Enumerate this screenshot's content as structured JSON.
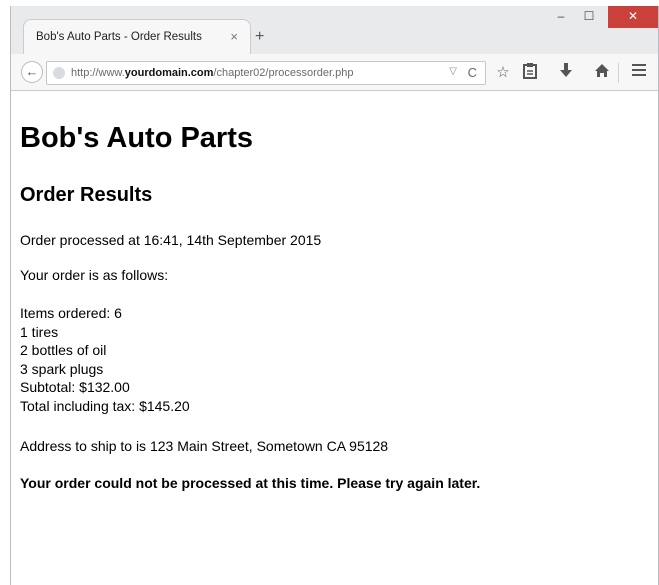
{
  "browser": {
    "tab_title": "Bob's Auto Parts - Order Results",
    "tab_close": "×",
    "new_tab": "+",
    "controls": {
      "minimize": "–",
      "maximize": "☐",
      "close": "✕"
    },
    "back": "←",
    "url": {
      "prefix": "http://www.",
      "domain": "yourdomain.com",
      "path": "/chapter02/processorder.php"
    },
    "url_dropdown": "▽",
    "reload": "C",
    "icons": [
      "star-icon",
      "clipboard-icon",
      "download-icon",
      "home-icon",
      "menu-icon"
    ]
  },
  "page": {
    "title": "Bob's Auto Parts",
    "heading": "Order Results",
    "processed": "Order processed at 16:41, 14th September 2015",
    "intro": "Your order is as follows:",
    "items": [
      "Items ordered: 6",
      "1 tires",
      "2 bottles of oil",
      "3 spark plugs",
      "Subtotal: $132.00",
      "Total including tax: $145.20"
    ],
    "address": "Address to ship to is 123 Main Street, Sometown CA 95128",
    "error": "Your order could not be processed at this time. Please try again later."
  }
}
